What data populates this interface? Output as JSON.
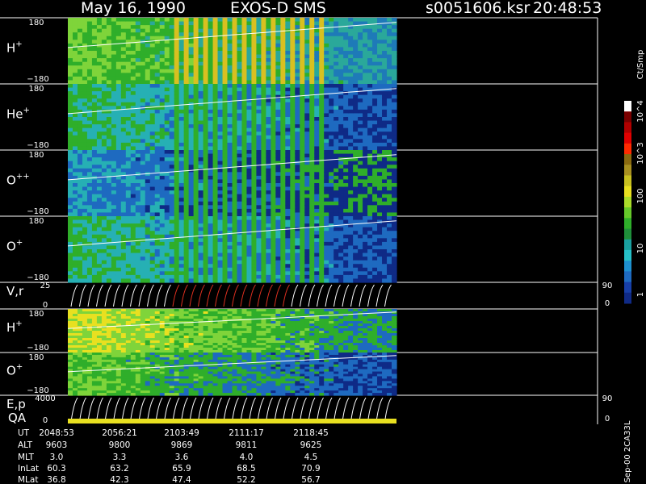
{
  "header": {
    "date": "May 16, 1990",
    "instrument": "EXOS-D SMS",
    "filename": "s0051606.ksr",
    "time": "20:48:53"
  },
  "chart_data": {
    "type": "heatmap",
    "title": "May 16, 1990   EXOS-D SMS",
    "panels": [
      {
        "label": "H",
        "sup": "+",
        "kind": "spec",
        "ymax": "180",
        "ymin": "−180",
        "colors": [
          "#7fd43a",
          "#2fae2a",
          "#2aa89a",
          "#1e7ab8"
        ]
      },
      {
        "label": "He",
        "sup": "+",
        "kind": "spec",
        "ymax": "180",
        "ymin": "−180",
        "colors": [
          "#2fae2a",
          "#26b0b4",
          "#1e6ac0",
          "#0f2a86"
        ]
      },
      {
        "label": "O",
        "sup": "++",
        "kind": "spec",
        "ymax": "180",
        "ymin": "−180",
        "colors": [
          "#26b0b4",
          "#1e6ac0",
          "#0f2a86",
          "#2fae2a"
        ]
      },
      {
        "label": "O",
        "sup": "+",
        "kind": "spec",
        "ymax": "180",
        "ymin": "−180",
        "colors": [
          "#2fae2a",
          "#26b0b4",
          "#1e6ac0",
          "#0f2a86"
        ]
      },
      {
        "label": "V,r",
        "sup": "",
        "kind": "vec",
        "ymax": "25",
        "ymin": "0",
        "rmax": "90",
        "rmin": "0"
      },
      {
        "label": "H",
        "sup": "+",
        "kind": "spec",
        "ymax": "180",
        "ymin": "−180",
        "colors": [
          "#e8e020",
          "#7fd43a",
          "#2fae2a",
          "#1e6ac0"
        ]
      },
      {
        "label": "O",
        "sup": "+",
        "kind": "spec",
        "ymax": "180",
        "ymin": "−180",
        "colors": [
          "#7fd43a",
          "#2fae2a",
          "#1e6ac0",
          "#0f2a86"
        ]
      },
      {
        "label": "E,p",
        "sup": "",
        "kind": "vec",
        "ymax": "4000",
        "ymin": "0",
        "rmax": "90",
        "rmin": "0",
        "qa_label": "QA"
      }
    ],
    "colorbar": {
      "title": "Ct/Smp",
      "tick_labels": [
        "10^4",
        "10^3",
        "100",
        "10",
        "1"
      ],
      "colors": [
        "#ffffff",
        "#7a0000",
        "#b00000",
        "#e00000",
        "#ff2a00",
        "#8a6a10",
        "#a89020",
        "#c8c020",
        "#e8e020",
        "#aadc2a",
        "#66c82a",
        "#2fae2a",
        "#1f8f3a",
        "#1aa0a0",
        "#26c0c8",
        "#1e90d0",
        "#1e6ac0",
        "#173fa8",
        "#0f2a86"
      ]
    },
    "x_axis": {
      "row_labels": [
        "UT",
        "ALT",
        "MLT",
        "InLat",
        "MLat"
      ],
      "columns": [
        [
          "2048:53",
          "9603",
          "3.0",
          "60.3",
          "36.8"
        ],
        [
          "2056:21",
          "9800",
          "3.3",
          "63.2",
          "42.3"
        ],
        [
          "2103:49",
          "9869",
          "3.6",
          "65.9",
          "47.4"
        ],
        [
          "2111:17",
          "9811",
          "4.0",
          "68.5",
          "52.2"
        ],
        [
          "2118:45",
          "9625",
          "4.5",
          "70.9",
          "56.7"
        ]
      ]
    },
    "side_note": "Sep-00 2CA33L"
  }
}
